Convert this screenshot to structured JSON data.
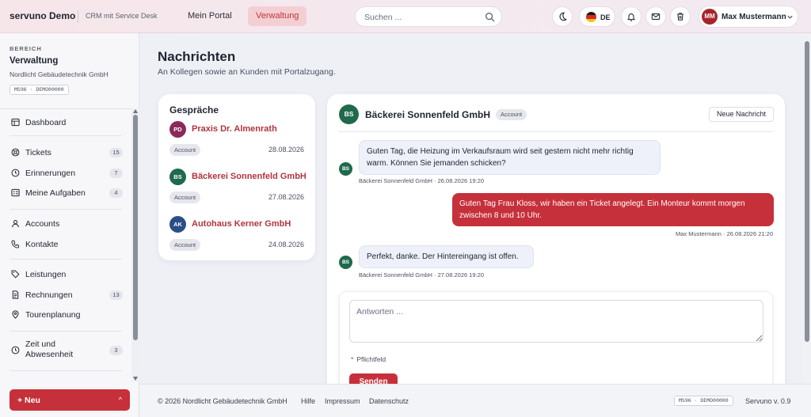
{
  "app": {
    "brand": "servuno Demo",
    "subtitle": "CRM mit Service Desk",
    "accent_color": "#c6303a"
  },
  "nav": {
    "portal": "Mein Portal",
    "admin": "Verwaltung"
  },
  "search": {
    "placeholder": "Suchen ..."
  },
  "topbar": {
    "language": "DE",
    "user_initials": "MM",
    "user_name": "Max Mustermann"
  },
  "sidebar": {
    "caption": "BEREICH",
    "title": "Verwaltung",
    "org": "Nordlicht Gebäudetechnik GmbH",
    "code": "MS96 · DEMO00000",
    "items": [
      {
        "label": "Dashboard",
        "icon": "dashboard-icon",
        "badge": ""
      },
      {
        "label": "Tickets",
        "icon": "tickets-icon",
        "badge": "15"
      },
      {
        "label": "Erinnerungen",
        "icon": "clock-icon",
        "badge": "7"
      },
      {
        "label": "Meine Aufgaben",
        "icon": "tasks-icon",
        "badge": "4"
      },
      {
        "label": "Accounts",
        "icon": "user-icon",
        "badge": ""
      },
      {
        "label": "Kontakte",
        "icon": "phone-icon",
        "badge": ""
      },
      {
        "label": "Leistungen",
        "icon": "tag-icon",
        "badge": ""
      },
      {
        "label": "Rechnungen",
        "icon": "invoice-icon",
        "badge": "13"
      },
      {
        "label": "Tourenplanung",
        "icon": "map-pin-icon",
        "badge": ""
      },
      {
        "label": "Zeit und Abwesenheit",
        "label_line1": "Zeit und",
        "label_line2": "Abwesenheit",
        "icon": "clock-icon",
        "badge": "3"
      }
    ],
    "new_button": "+ Neu",
    "new_chevron": "^"
  },
  "page": {
    "title": "Nachrichten",
    "subtitle": "An Kollegen sowie an Kunden mit Portalzugang."
  },
  "conversations": {
    "heading": "Gespräche",
    "items": [
      {
        "initials": "PD",
        "name": "Praxis Dr. Almenrath",
        "tag": "Account",
        "date": "28.08.2026",
        "color": "#8a2a5a"
      },
      {
        "initials": "BS",
        "name": "Bäckerei Sonnenfeld GmbH",
        "tag": "Account",
        "date": "27.08.2026",
        "color": "#1f6a4c"
      },
      {
        "initials": "AK",
        "name": "Autohaus Kerner GmbH",
        "tag": "Account",
        "date": "24.08.2026",
        "color": "#2a4f86"
      }
    ]
  },
  "chat": {
    "initials": "BS",
    "name": "Bäckerei Sonnenfeld GmbH",
    "tag": "Account",
    "new_message": "Neue Nachricht",
    "messages": [
      {
        "direction": "in",
        "initials": "BS",
        "text": "Guten Tag, die Heizung im Verkaufsraum wird seit gestern nicht mehr richtig warm. Können Sie jemanden schicken?",
        "meta": "Bäckerei Sonnenfeld GmbH · 26.08.2026 19:20"
      },
      {
        "direction": "out",
        "text": "Guten Tag Frau Kloss, wir haben ein Ticket angelegt. Ein Monteur kommt morgen zwischen 8 und 10 Uhr.",
        "meta": "Max Mustermann · 26.08.2026 21:20"
      },
      {
        "direction": "in",
        "initials": "BS",
        "text": "Perfekt, danke. Der Hintereingang ist offen.",
        "meta": "Bäckerei Sonnenfeld GmbH · 27.08.2026 19:20"
      }
    ],
    "reply_placeholder": "Antworten ...",
    "required_star": "*",
    "required": "Pflichtfeld",
    "send": "Senden"
  },
  "footer": {
    "copyright": "© 2026 Nordlicht Gebäudetechnik GmbH",
    "links": [
      "Hilfe",
      "Impressum",
      "Datenschutz"
    ],
    "code": "MS96 · DEMO00000",
    "version": "Servuno v. 0.9"
  }
}
